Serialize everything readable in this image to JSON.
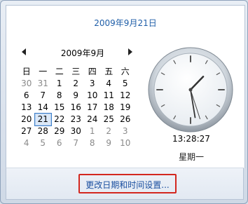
{
  "header": {
    "full_date": "2009年9月21日"
  },
  "calendar": {
    "month_title": "2009年9月",
    "prev_icon": "triangle-left",
    "next_icon": "triangle-right",
    "weekdays": [
      "日",
      "一",
      "二",
      "三",
      "四",
      "五",
      "六"
    ],
    "weeks": [
      [
        "30",
        "31",
        "1",
        "2",
        "3",
        "4",
        "5"
      ],
      [
        "6",
        "7",
        "8",
        "9",
        "10",
        "11",
        "12"
      ],
      [
        "13",
        "14",
        "15",
        "16",
        "17",
        "18",
        "19"
      ],
      [
        "20",
        "21",
        "22",
        "23",
        "24",
        "25",
        "26"
      ],
      [
        "27",
        "28",
        "29",
        "30",
        "1",
        "2",
        "3"
      ],
      [
        "4",
        "5",
        "6",
        "7",
        "8",
        "9",
        "10"
      ]
    ],
    "selected_day": "21"
  },
  "clock": {
    "time": "13:28:27",
    "weekday": "星期一"
  },
  "footer": {
    "settings_link": "更改日期和时间设置..."
  },
  "colors": {
    "accent": "#1f5ea8",
    "highlight": "#d3271f"
  }
}
